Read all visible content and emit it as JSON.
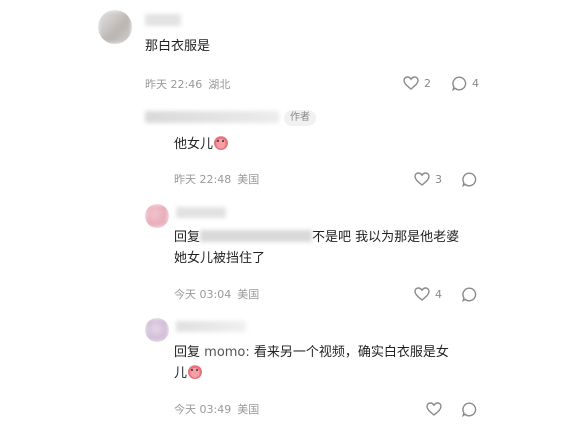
{
  "comments": [
    {
      "text": "那白衣服是",
      "time": "昨天 22:46",
      "location": "湖北",
      "likes": "2",
      "replies": "4"
    },
    {
      "author_tag": "作者",
      "text": "他女儿",
      "time": "昨天 22:48",
      "location": "美国",
      "likes": "3"
    },
    {
      "reply_prefix": "回复",
      "text_after": "不是吧 我以为那是他老婆",
      "text_line2": "她女儿被挡住了",
      "time": "今天 03:04",
      "location": "美国",
      "likes": "4"
    },
    {
      "reply_prefix": "回复",
      "reply_to": "momo:",
      "text_line1": "看来另一个视频，确实白衣服是女",
      "text_line2": "儿",
      "time": "今天 03:49",
      "location": "美国"
    }
  ],
  "icons": [
    "heart-icon",
    "comment-icon"
  ]
}
